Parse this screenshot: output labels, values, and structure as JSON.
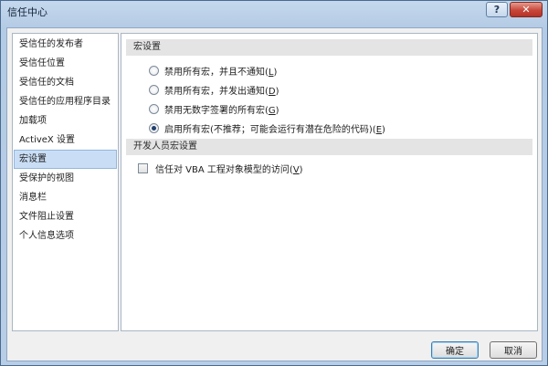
{
  "window": {
    "title": "信任中心",
    "help_glyph": "?",
    "close_glyph": "✕"
  },
  "sidebar": {
    "items": [
      {
        "label": "受信任的发布者"
      },
      {
        "label": "受信任位置"
      },
      {
        "label": "受信任的文档"
      },
      {
        "label": "受信任的应用程序目录"
      },
      {
        "label": "加载项"
      },
      {
        "label": "ActiveX 设置"
      },
      {
        "label": "宏设置",
        "selected": true
      },
      {
        "label": "受保护的视图"
      },
      {
        "label": "消息栏"
      },
      {
        "label": "文件阻止设置"
      },
      {
        "label": "个人信息选项"
      }
    ]
  },
  "macro_settings": {
    "header": "宏设置",
    "options": [
      {
        "text": "禁用所有宏，并且不通知(",
        "key": "L",
        "end": ")",
        "checked": false
      },
      {
        "text": "禁用所有宏，并发出通知(",
        "key": "D",
        "end": ")",
        "checked": false
      },
      {
        "text": "禁用无数字签署的所有宏(",
        "key": "G",
        "end": ")",
        "checked": false
      },
      {
        "text": "启用所有宏(不推荐；可能会运行有潜在危险的代码)(",
        "key": "E",
        "end": ")",
        "checked": true
      }
    ]
  },
  "developer_settings": {
    "header": "开发人员宏设置",
    "checkbox": {
      "text": "信任对 VBA 工程对象模型的访问(",
      "key": "V",
      "end": ")",
      "checked": false
    }
  },
  "buttons": {
    "ok": "确定",
    "cancel": "取消"
  },
  "colors": {
    "selected_bg": "#c9def5",
    "section_bg": "#e4e4e4",
    "close_red": "#c8473a"
  }
}
